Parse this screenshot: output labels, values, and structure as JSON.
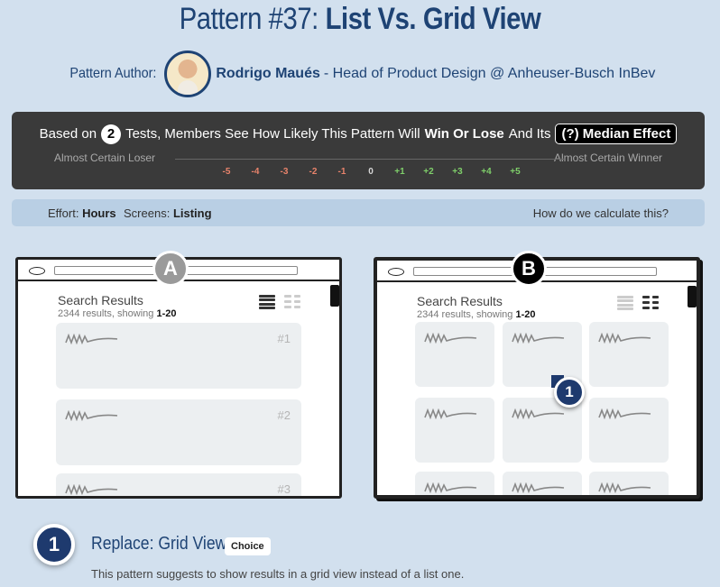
{
  "header": {
    "title_prefix": "Pattern #37:",
    "title_main": "List Vs. Grid View"
  },
  "author": {
    "label": "Pattern Author:",
    "name": "Rodrigo Maués",
    "role": "- Head of Product Design @ Anheuser-Busch InBev"
  },
  "stats": {
    "based_on": "Based on",
    "tests_count": "2",
    "sentence_mid": "Tests, Members See How Likely This Pattern Will",
    "win_lose": "Win Or Lose",
    "and_its": "And Its",
    "median_effect": "(?) Median Effect",
    "left_label": "Almost Certain Loser",
    "right_label": "Almost Certain Winner",
    "ticks": [
      {
        "label": "-5",
        "color": "#e8836b"
      },
      {
        "label": "-4",
        "color": "#e8836b"
      },
      {
        "label": "-3",
        "color": "#e8836b"
      },
      {
        "label": "-2",
        "color": "#e8836b"
      },
      {
        "label": "-1",
        "color": "#e8836b"
      },
      {
        "label": "0",
        "color": "#d6d6d6"
      },
      {
        "label": "+1",
        "color": "#7fcf6a"
      },
      {
        "label": "+2",
        "color": "#7fcf6a"
      },
      {
        "label": "+3",
        "color": "#7fcf6a"
      },
      {
        "label": "+4",
        "color": "#7fcf6a"
      },
      {
        "label": "+5",
        "color": "#7fcf6a"
      }
    ]
  },
  "effort": {
    "effort_label": "Effort:",
    "effort_value": "Hours",
    "screens_label": "Screens:",
    "screens_value": "Listing",
    "calc_link": "How do we calculate this?"
  },
  "variant_a": {
    "badge": "A",
    "heading": "Search Results",
    "results_text": "2344 results, showing",
    "results_range": "1-20",
    "items": [
      "#1",
      "#2",
      "#3"
    ]
  },
  "variant_b": {
    "badge": "B",
    "heading": "Search Results",
    "results_text": "2344 results, showing",
    "results_range": "1-20",
    "marker": "1"
  },
  "change": {
    "number": "1",
    "title": "Replace: Grid View",
    "tag": "Choice",
    "description": "This pattern suggests to show results in a grid view instead of a list one."
  }
}
